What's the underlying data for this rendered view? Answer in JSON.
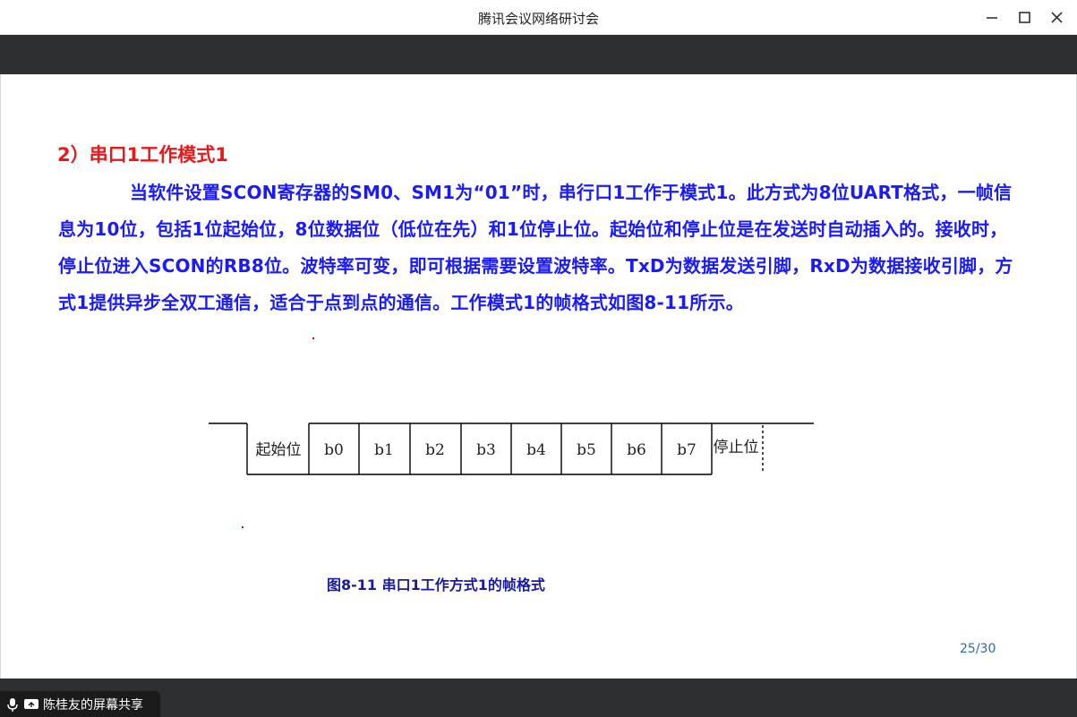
{
  "window": {
    "title": "腾讯会议网络研讨会"
  },
  "slide": {
    "heading": "2）串口1工作模式1",
    "paragraph": "当软件设置SCON寄存器的SM0、SM1为“01”时，串行口1工作于模式1。此方式为8位UART格式，一帧信息为10位，包括1位起始位，8位数据位（低位在先）和1位停止位。起始位和停止位是在发送时自动插入的。接收时，停止位进入SCON的RB8位。波特率可变，即可根据需要设置波特率。TxD为数据发送引脚，RxD为数据接收引脚，方式1提供异步全双工通信，适合于点到点的通信。工作模式1的帧格式如图8-11所示。",
    "frame": {
      "start_label": "起始位",
      "bits": [
        "b0",
        "b1",
        "b2",
        "b3",
        "b4",
        "b5",
        "b6",
        "b7"
      ],
      "stop_label": "停止位"
    },
    "caption": "图8-11  串口1工作方式1的帧格式",
    "page_number": "25/30"
  },
  "share": {
    "label": "陈桂友的屏幕共享"
  },
  "colors": {
    "heading": "#e8191b",
    "body_text": "#1a1aff",
    "caption": "#1a1aa0",
    "page_number": "#2b6cb0",
    "bars": "#2e2f31"
  }
}
